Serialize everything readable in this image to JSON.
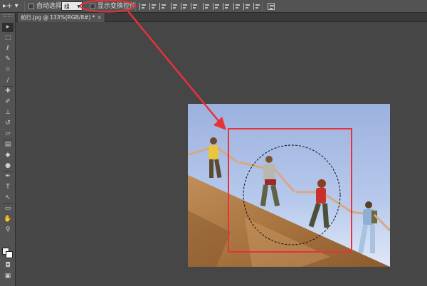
{
  "options_bar": {
    "tool_glyph": "▸+ ▾",
    "auto_select_label": "自动选择:",
    "auto_select_value": "组",
    "show_transform_label": "显示变换控件"
  },
  "tab": {
    "title": "前行.jpg @ 133%(RGB/8#) *",
    "close": "×"
  },
  "toolbar": {
    "tools": [
      {
        "name": "move-tool-icon",
        "glyph": "▸"
      },
      {
        "name": "marquee-tool-icon",
        "glyph": "⬚"
      },
      {
        "name": "lasso-tool-icon",
        "glyph": "ℓ"
      },
      {
        "name": "quick-select-tool-icon",
        "glyph": "✎"
      },
      {
        "name": "crop-tool-icon",
        "glyph": "⌗"
      },
      {
        "name": "eyedropper-tool-icon",
        "glyph": "∕"
      },
      {
        "name": "healing-tool-icon",
        "glyph": "✚"
      },
      {
        "name": "brush-tool-icon",
        "glyph": "✐"
      },
      {
        "name": "stamp-tool-icon",
        "glyph": "⊥"
      },
      {
        "name": "history-brush-tool-icon",
        "glyph": "↺"
      },
      {
        "name": "eraser-tool-icon",
        "glyph": "▱"
      },
      {
        "name": "gradient-tool-icon",
        "glyph": "▤"
      },
      {
        "name": "blur-tool-icon",
        "glyph": "◆"
      },
      {
        "name": "dodge-tool-icon",
        "glyph": "●"
      },
      {
        "name": "pen-tool-icon",
        "glyph": "✒"
      },
      {
        "name": "type-tool-icon",
        "glyph": "T"
      },
      {
        "name": "path-select-tool-icon",
        "glyph": "↖"
      },
      {
        "name": "shape-tool-icon",
        "glyph": "▭"
      },
      {
        "name": "hand-tool-icon",
        "glyph": "✋"
      },
      {
        "name": "zoom-tool-icon",
        "glyph": "⚲"
      }
    ],
    "quickmask_glyph": "◘",
    "screenmode_glyph": "▣"
  },
  "colors": {
    "annotation_red": "#e8323a",
    "selection_rect_red": "#e8323a"
  }
}
